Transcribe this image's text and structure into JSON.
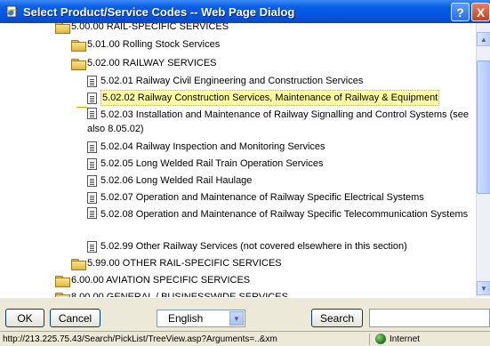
{
  "window": {
    "title": "Select Product/Service Codes -- Web Page Dialog",
    "help_glyph": "?",
    "close_glyph": "X"
  },
  "tree": [
    {
      "icon": "folder-open",
      "label": "5.00.00 RAIL-SPECIFIC SERVICES"
    },
    {
      "icon": "folder",
      "label": "5.01.00 Rolling Stock Services"
    },
    {
      "icon": "folder-open",
      "label": "5.02.00 RAILWAY SERVICES"
    },
    {
      "icon": "document",
      "label": "5.02.01 Railway Civil Engineering and Construction Services"
    },
    {
      "icon": "document",
      "label": "5.02.02 Railway Construction Services, Maintenance of Railway & Equipment",
      "selected": true
    },
    {
      "icon": "document",
      "label": "5.02.03 Installation and Maintenance of Railway Signalling and Control Systems (see also 8.05.02)"
    },
    {
      "icon": "document",
      "label": "5.02.04 Railway Inspection and Monitoring Services"
    },
    {
      "icon": "document",
      "label": "5.02.05 Long Welded Rail Train Operation Services"
    },
    {
      "icon": "document",
      "label": "5.02.06 Long Welded Rail Haulage"
    },
    {
      "icon": "document",
      "label": "5.02.07 Operation and Maintenance of Railway Specific Electrical Systems"
    },
    {
      "icon": "document",
      "label": "5.02.08 Operation and Maintenance of Railway Specific Telecommunication Systems"
    },
    {
      "icon": "document",
      "label": "5.02.99 Other Railway Services (not covered elsewhere in this section)"
    },
    {
      "icon": "folder",
      "label": "5.99.00 OTHER RAIL-SPECIFIC SERVICES"
    },
    {
      "icon": "folder",
      "label": "6.00.00 AVIATION SPECIFIC SERVICES"
    },
    {
      "icon": "folder",
      "label": "8.00.00 GENERAL / BUSINESSWIDE SERVICES"
    }
  ],
  "toolbar": {
    "ok_label": "OK",
    "cancel_label": "Cancel",
    "language_selected": "English",
    "search_label": "Search",
    "search_value": ""
  },
  "status": {
    "url": "http://213.225.75.43/Search/PickList/TreeView.asp?Arguments=..&xm",
    "zone": "Internet"
  },
  "colors": {
    "titlebar": "#0554e0",
    "selection_highlight": "#ffffa0",
    "close_button": "#c8401c"
  }
}
